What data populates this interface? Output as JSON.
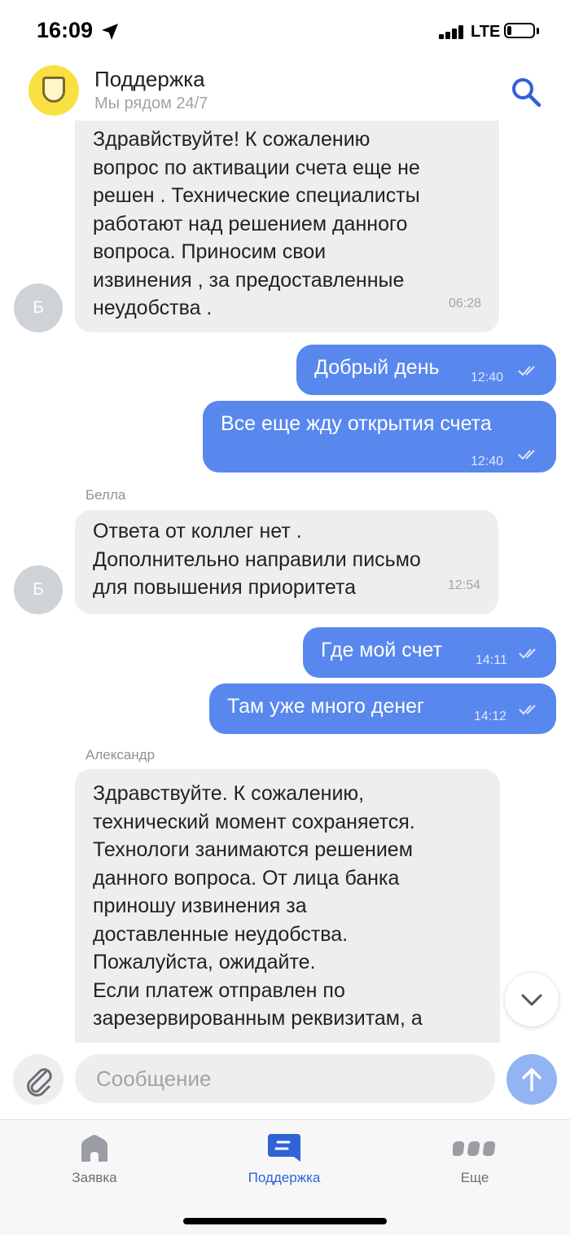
{
  "status_bar": {
    "time": "16:09",
    "network": "LTE"
  },
  "header": {
    "title": "Поддержка",
    "subtitle": "Мы рядом 24/7"
  },
  "messages": [
    {
      "direction": "in",
      "lines": [
        "Здравйствуйте! К сожалению",
        "вопрос по активации счета еще не",
        "решен . Технические специалисты",
        "работают над решением  данного",
        "вопроса. Приносим свои",
        "извинения , за предоставленные",
        "неудобства ."
      ],
      "time": "06:28",
      "avatar": "Б"
    },
    {
      "direction": "out",
      "text": "Добрый день",
      "time": "12:40",
      "read": true
    },
    {
      "direction": "out",
      "text": "Все еще жду открытия счета",
      "time": "12:40",
      "read": true
    },
    {
      "direction": "in",
      "sender": "Белла",
      "lines": [
        "Ответа от коллег нет .",
        "Дополнительно направили письмо",
        "для повышения приоритета"
      ],
      "time": "12:54",
      "avatar": "Б"
    },
    {
      "direction": "out",
      "text": "Где мой счет",
      "time": "14:11",
      "read": true
    },
    {
      "direction": "out",
      "text": "Там уже много денег",
      "time": "14:12",
      "read": true
    },
    {
      "direction": "in",
      "sender": "Александр",
      "lines": [
        "Здравствуйте. К сожалению,",
        "технический момент сохраняется.",
        "Технологи занимаются решением",
        "данного вопроса. От лица банка",
        "приношу извинения за",
        "доставленные неудобства.",
        "Пожалуйста, ожидайте.",
        "Если платеж отправлен по",
        "зарезервированным реквизитам, а"
      ]
    }
  ],
  "composer": {
    "placeholder": "Сообщение",
    "value": ""
  },
  "tabs": [
    {
      "label": "Заявка",
      "icon": "home-icon",
      "active": false
    },
    {
      "label": "Поддержка",
      "icon": "chat-icon",
      "active": true
    },
    {
      "label": "Еще",
      "icon": "more-icon",
      "active": false
    }
  ],
  "colors": {
    "accent": "#3062d8",
    "outgoing_bubble": "#5887ee",
    "incoming_bubble": "#eeeeef",
    "logo": "#f9e042"
  }
}
